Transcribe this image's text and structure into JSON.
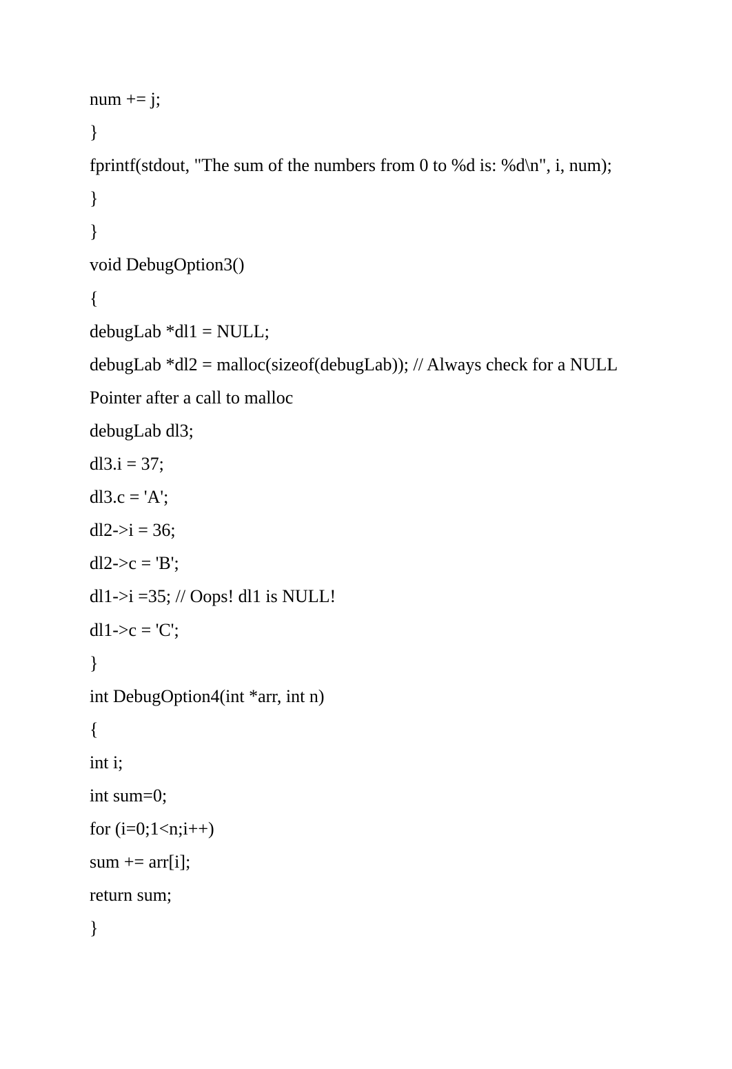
{
  "code": {
    "lines": [
      "num += j;",
      "}",
      "fprintf(stdout, \"The sum of the numbers from 0 to %d is: %d\\n\", i, num);",
      "}",
      "}",
      "void DebugOption3()",
      "{",
      "debugLab *dl1 = NULL;",
      "debugLab *dl2 = malloc(sizeof(debugLab)); // Always check for a NULL Pointer after a call to malloc",
      "debugLab dl3;",
      "dl3.i = 37;",
      "dl3.c = 'A';",
      "dl2->i = 36;",
      "dl2->c = 'B';",
      "dl1->i =35; // Oops! dl1 is NULL!",
      "dl1->c = 'C';",
      "}",
      "int DebugOption4(int *arr, int n)",
      "{",
      "int i;",
      "int sum=0;",
      "for (i=0;1<n;i++)",
      "sum += arr[i];",
      "return sum;",
      "}"
    ]
  }
}
